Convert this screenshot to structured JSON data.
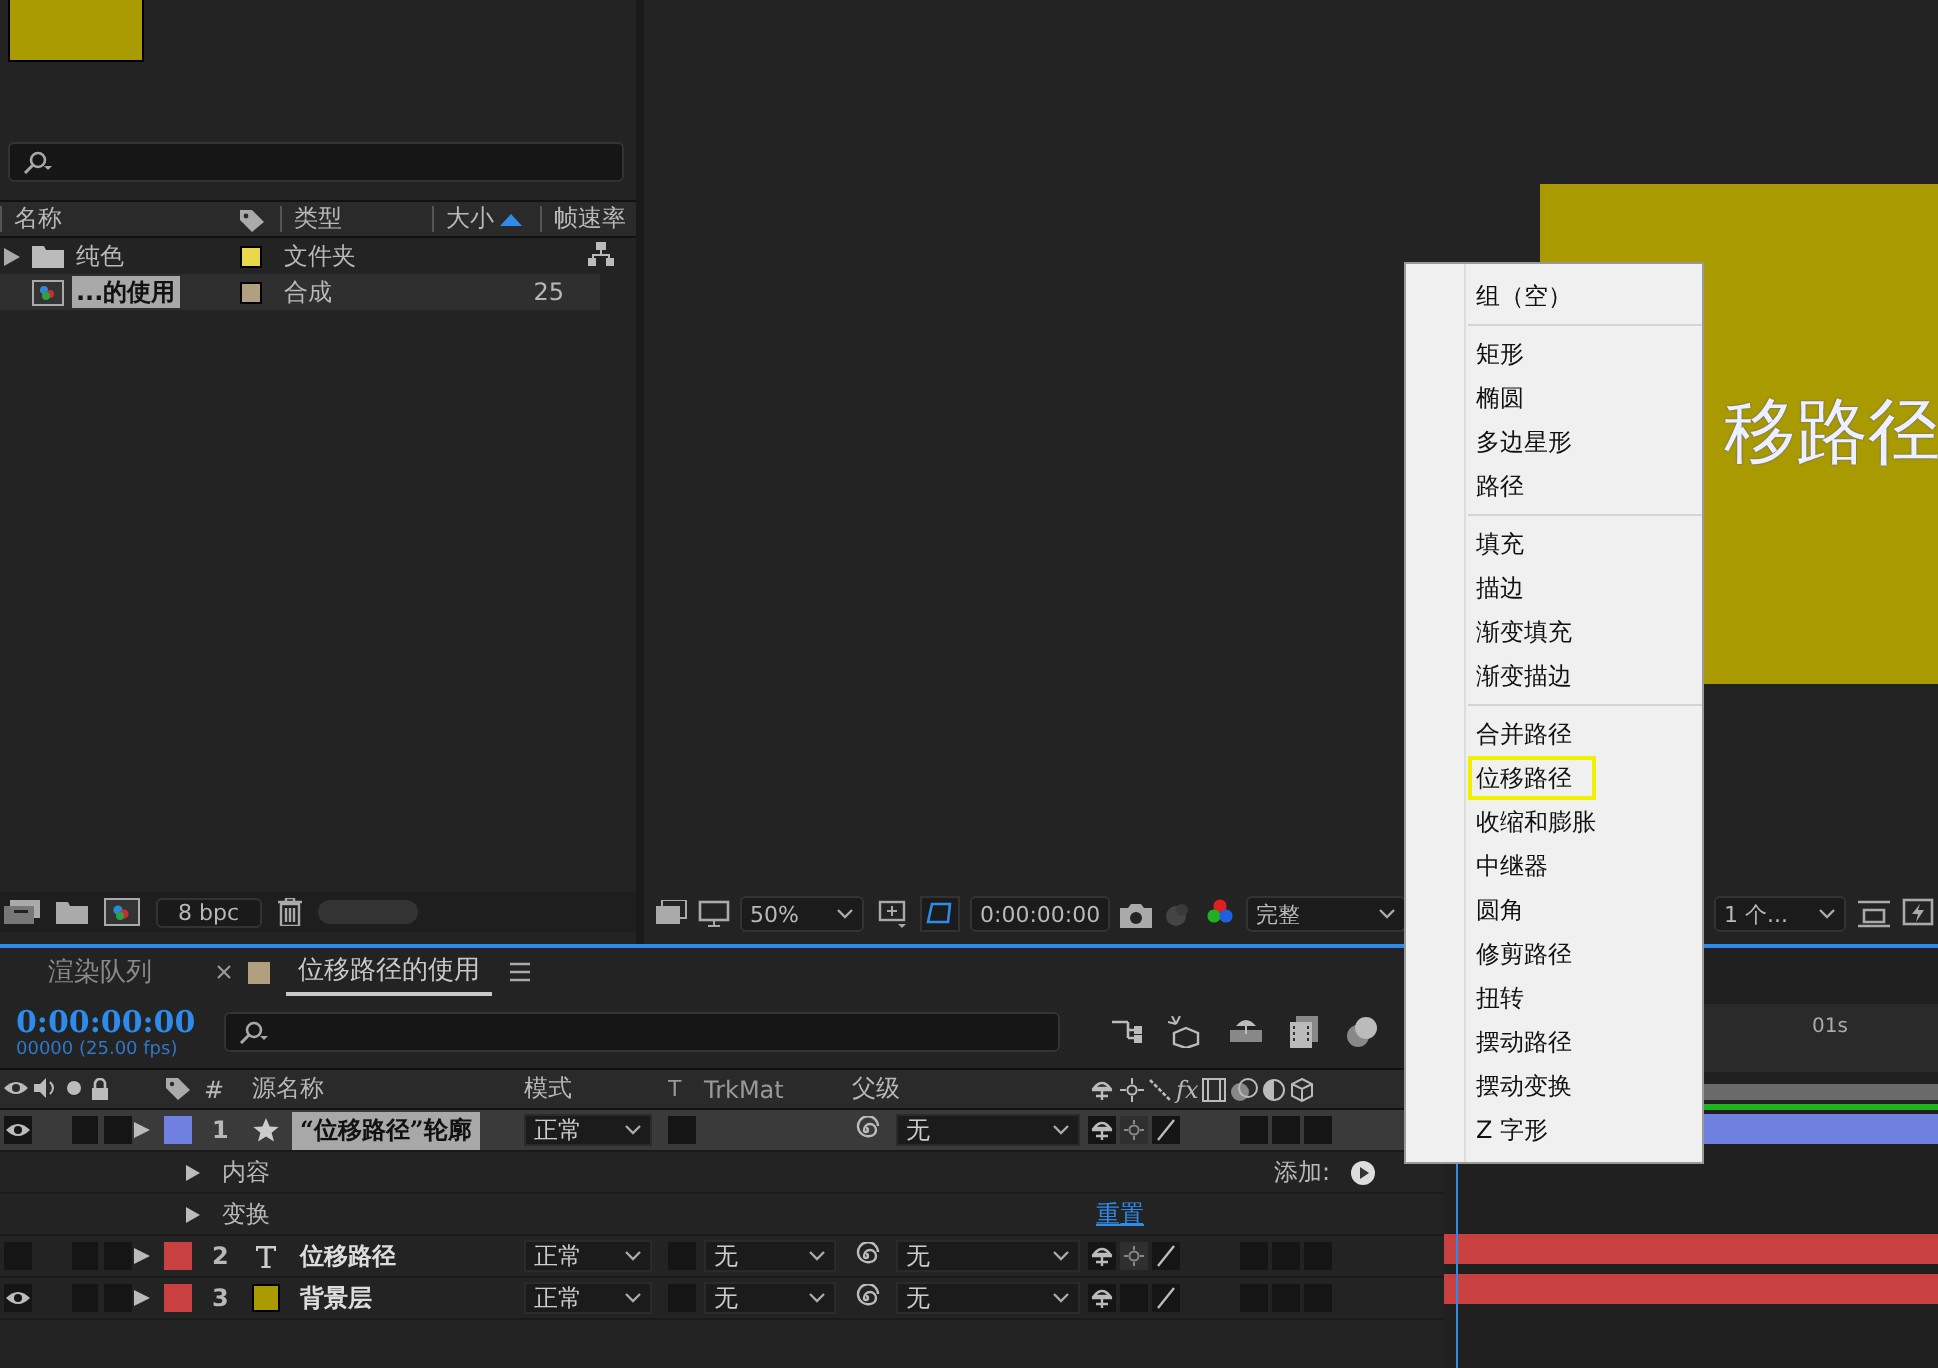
{
  "project": {
    "columns": [
      "名称",
      "类型",
      "大小",
      "帧速率"
    ],
    "items": [
      {
        "kind": "folder",
        "name": "纯色",
        "type": "文件夹",
        "color": "#e8d84a",
        "selected": false
      },
      {
        "kind": "comp",
        "name": "...的使用",
        "type": "合成",
        "fps": "25",
        "color": "#b0a080",
        "selected": true
      }
    ],
    "bpc": "8 bpc"
  },
  "viewer": {
    "comp_text": "移路径",
    "zoom": "50%",
    "timecode": "0:00:00:00",
    "resolution": "完整",
    "views": "1 个..."
  },
  "timeline": {
    "tabs": [
      {
        "kind": "queue",
        "label": "渲染队列",
        "selected": false
      },
      {
        "kind": "comp",
        "label": "位移路径的使用",
        "selected": true,
        "color": "#b0a080"
      }
    ],
    "time": "0:00:00:00",
    "frame_info": "00000 (25.00 fps)",
    "ruler_label": "01s",
    "headers": {
      "number": "#",
      "source": "源名称",
      "mode": "模式",
      "t": "T",
      "trkmat": "TrkMat",
      "parent": "父级",
      "effects": "fx"
    },
    "layers": [
      {
        "number": "1",
        "kind": "shape",
        "name": "“位移路径”轮廓",
        "color": "#6f80e0",
        "selected": true,
        "visible": true,
        "mode": "正常",
        "parent": "无",
        "properties": [
          {
            "label": "内容",
            "action": "添加:"
          },
          {
            "label": "变换",
            "link": "重置"
          }
        ]
      },
      {
        "number": "2",
        "kind": "text",
        "name": "位移路径",
        "color": "#c84040",
        "selected": false,
        "visible": false,
        "mode": "正常",
        "trkmat": "无",
        "parent": "无"
      },
      {
        "number": "3",
        "kind": "solid",
        "name": "背景层",
        "color": "#c84040",
        "selected": false,
        "visible": true,
        "mode": "正常",
        "trkmat": "无",
        "parent": "无"
      }
    ]
  },
  "menu": {
    "sections": [
      [
        {
          "label": "组（空）",
          "selected": false
        }
      ],
      [
        {
          "label": "矩形",
          "selected": false
        },
        {
          "label": "椭圆",
          "selected": false
        },
        {
          "label": "多边星形",
          "selected": false
        },
        {
          "label": "路径",
          "selected": false
        }
      ],
      [
        {
          "label": "填充",
          "selected": false
        },
        {
          "label": "描边",
          "selected": false
        },
        {
          "label": "渐变填充",
          "selected": false
        },
        {
          "label": "渐变描边",
          "selected": false
        }
      ],
      [
        {
          "label": "合并路径",
          "selected": false
        },
        {
          "label": "位移路径",
          "selected": true
        },
        {
          "label": "收缩和膨胀",
          "selected": false
        },
        {
          "label": "中继器",
          "selected": false
        },
        {
          "label": "圆角",
          "selected": false
        },
        {
          "label": "修剪路径",
          "selected": false
        },
        {
          "label": "扭转",
          "selected": false
        },
        {
          "label": "摆动路径",
          "selected": false
        },
        {
          "label": "摆动变换",
          "selected": false
        },
        {
          "label": "Z 字形",
          "selected": false
        }
      ]
    ]
  }
}
